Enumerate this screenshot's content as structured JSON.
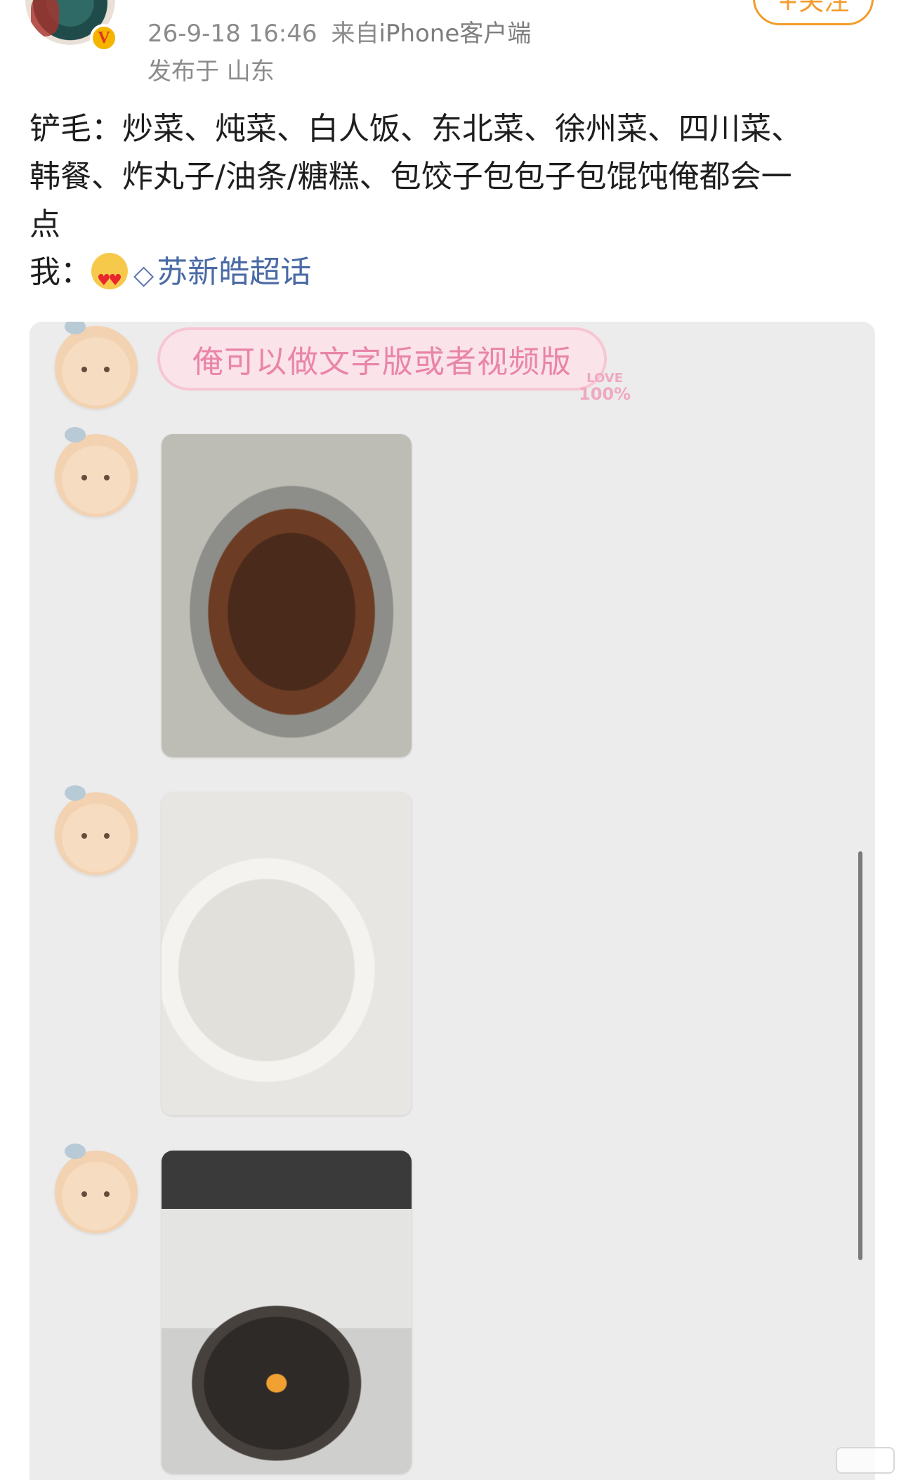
{
  "header": {
    "timestamp": "26-9-18 16:46",
    "source": "来自",
    "client": "iPhone客户端",
    "location": "发布于 山东",
    "verified_badge": "V",
    "follow_label": "+关注"
  },
  "post": {
    "line1": "铲毛：炒菜、炖菜、白人饭、东北菜、徐州菜、四川菜、",
    "line2": "韩餐、炸丸子/油条/糖糕、包饺子包包子包馄饨俺都会一",
    "line3": "点",
    "line4_prefix": "我：",
    "emoji": "heart-eyes-emoji",
    "topic_icon": "diamond-topic-icon",
    "topic": "苏新皓超话"
  },
  "card": {
    "bubble_text": "俺可以做文字版或者视频版",
    "sticker_love": "LOVE",
    "sticker_pct": "100%",
    "images": [
      {
        "name": "braised-beef-photo"
      },
      {
        "name": "congee-photo"
      },
      {
        "name": "frying-cakes-photo"
      }
    ]
  },
  "colors": {
    "meta": "#8b8b8b",
    "topic": "#4a6aa5",
    "follow": "#f39c2b",
    "bubble_bg": "#fbe3ea",
    "bubble_text": "#e985a8",
    "card_bg": "#ececec"
  }
}
